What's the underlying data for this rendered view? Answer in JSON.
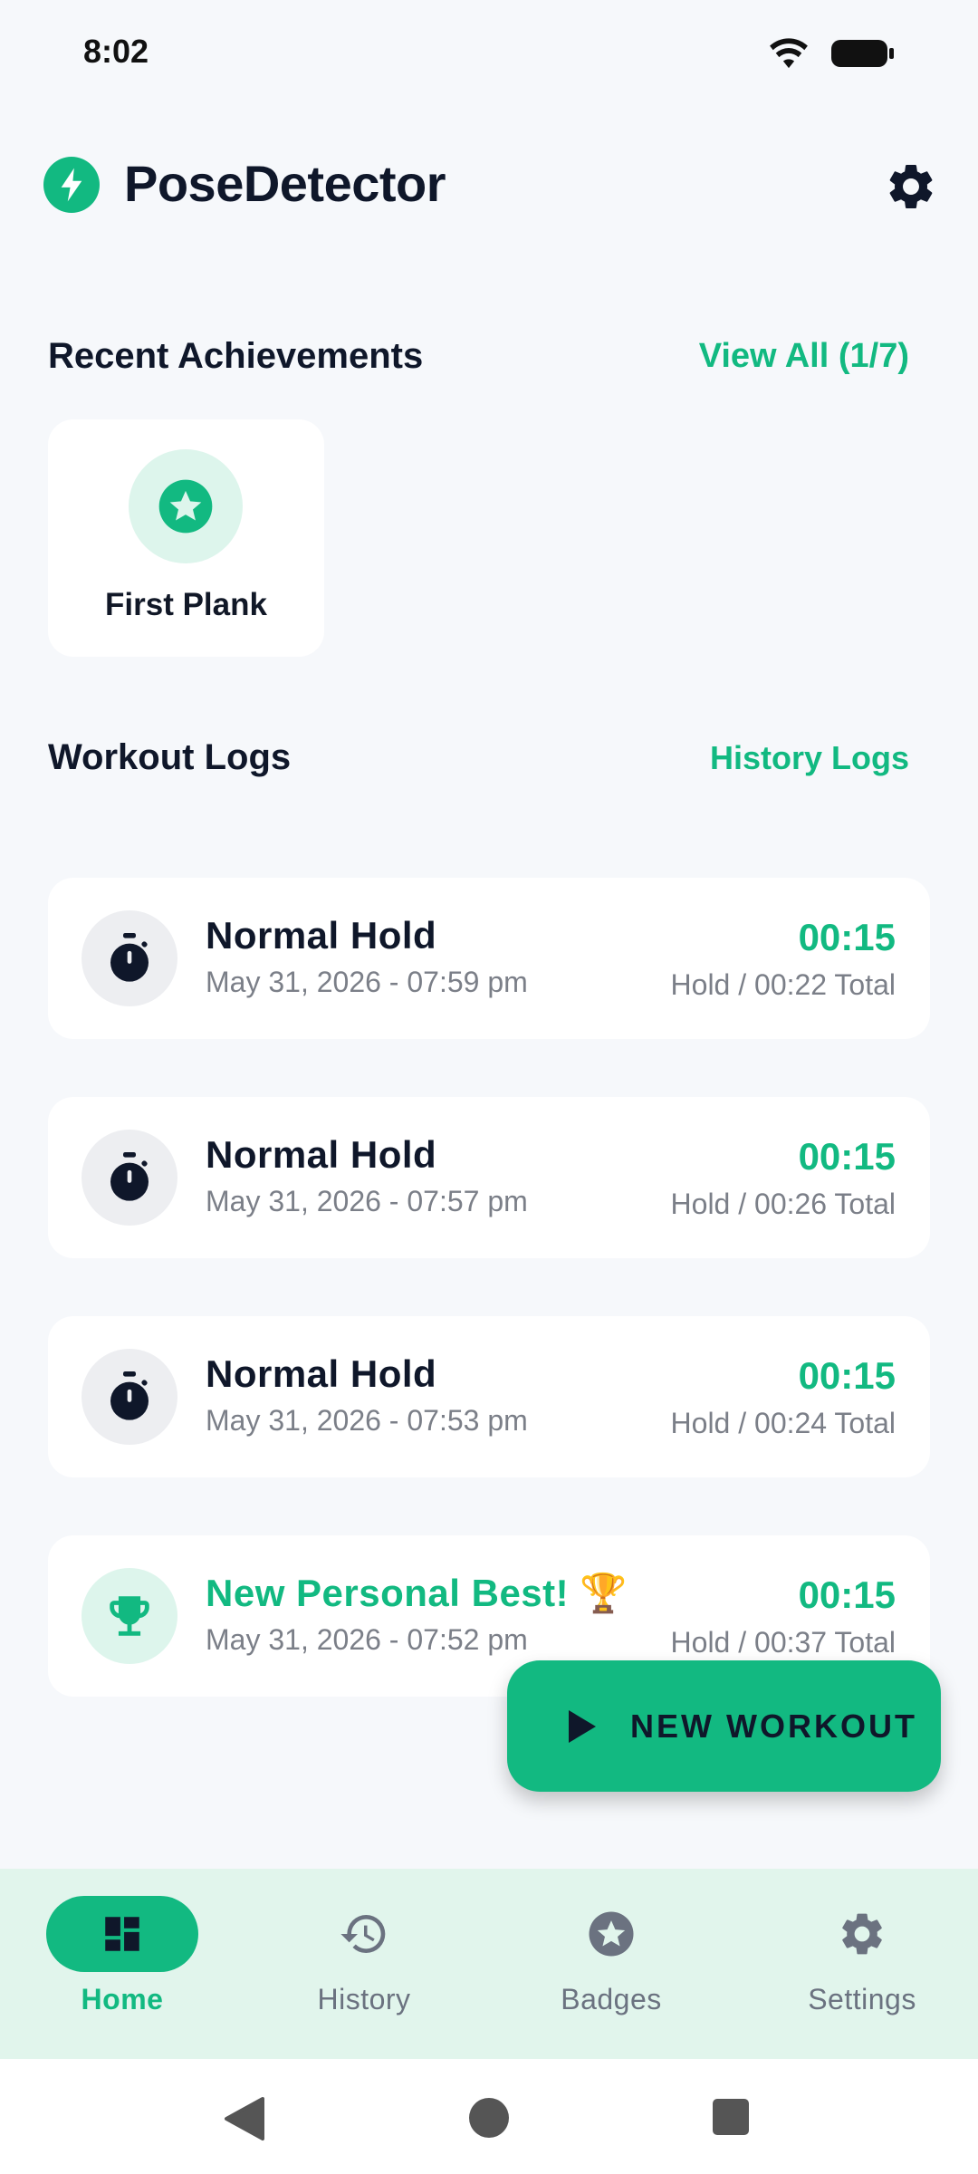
{
  "status_bar": {
    "time": "8:02"
  },
  "app": {
    "title": "PoseDetector"
  },
  "achievements": {
    "section_title": "Recent Achievements",
    "view_all_label": "View All (1/7)",
    "items": [
      {
        "label": "First Plank",
        "icon": "star-badge-icon"
      }
    ]
  },
  "workout_logs": {
    "section_title": "Workout Logs",
    "history_link": "History Logs",
    "entries": [
      {
        "title": "Normal Hold",
        "date": "May 31, 2026 - 07:59 pm",
        "hold": "00:15",
        "total": "Hold / 00:22 Total",
        "icon": "stopwatch-icon"
      },
      {
        "title": "Normal Hold",
        "date": "May 31, 2026 - 07:57 pm",
        "hold": "00:15",
        "total": "Hold / 00:26 Total",
        "icon": "stopwatch-icon"
      },
      {
        "title": "Normal Hold",
        "date": "May 31, 2026 - 07:53 pm",
        "hold": "00:15",
        "total": "Hold / 00:24 Total",
        "icon": "stopwatch-icon"
      },
      {
        "title": "New Personal Best! 🏆",
        "date": "May 31, 2026 - 07:52 pm",
        "hold": "00:15",
        "total": "Hold / 00:37 Total",
        "icon": "trophy-icon"
      }
    ]
  },
  "fab": {
    "label": "NEW WORKOUT"
  },
  "bottom_nav": {
    "items": [
      {
        "label": "Home",
        "icon": "dashboard-icon",
        "active": true
      },
      {
        "label": "History",
        "icon": "history-icon",
        "active": false
      },
      {
        "label": "Badges",
        "icon": "badge-star-icon",
        "active": false
      },
      {
        "label": "Settings",
        "icon": "gear-icon",
        "active": false
      }
    ]
  },
  "colors": {
    "accent": "#12B981",
    "background": "#F6F8FB",
    "nav_background": "#E1F5EC"
  }
}
